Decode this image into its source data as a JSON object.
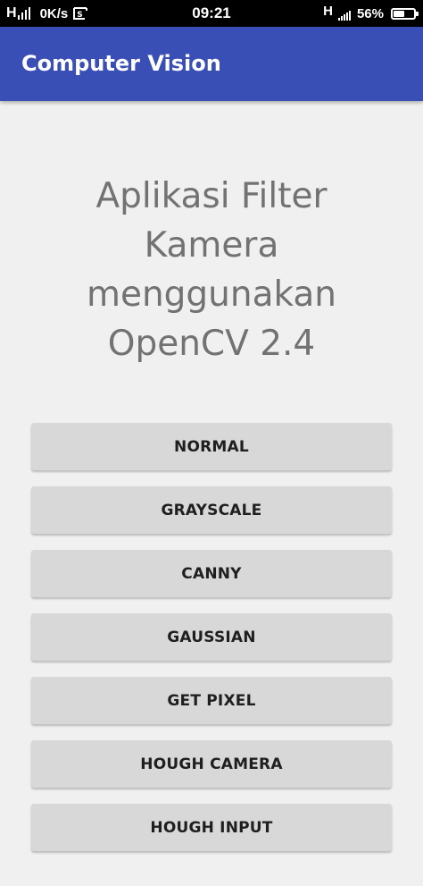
{
  "status_bar": {
    "network_left": "H",
    "speed": "0K/s",
    "time": "09:21",
    "network_right": "H",
    "battery_percent": "56%",
    "battery_level": 0.56,
    "icons": [
      "signal-bars-icon",
      "data-saver-icon",
      "signal-mini-icon",
      "battery-icon"
    ]
  },
  "app_bar": {
    "title": "Computer Vision",
    "color": "#3a4fb5"
  },
  "main": {
    "headline": "Aplikasi Filter Kamera menggunakan OpenCV 2.4",
    "buttons": [
      {
        "label": "NORMAL"
      },
      {
        "label": "GRAYSCALE"
      },
      {
        "label": "CANNY"
      },
      {
        "label": "GAUSSIAN"
      },
      {
        "label": "GET PIXEL"
      },
      {
        "label": "HOUGH CAMERA"
      },
      {
        "label": "HOUGH INPUT"
      }
    ]
  }
}
